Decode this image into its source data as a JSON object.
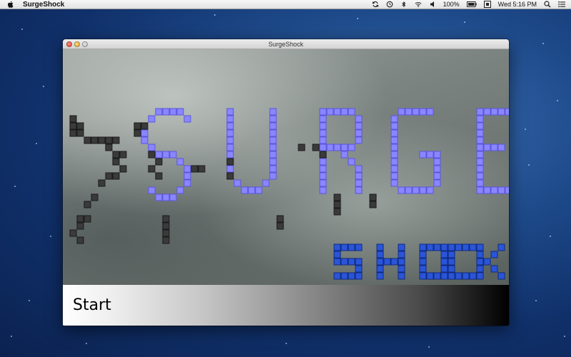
{
  "menubar": {
    "app_name": "SurgeShock",
    "battery": "100%",
    "clock": "Wed 5:16 PM"
  },
  "window": {
    "title": "SurgeShock"
  },
  "game": {
    "start_label": "Start"
  },
  "colors": {
    "title_blue": "#8a86ff",
    "title_blue_dark": "#5a56d8",
    "dark_block": "#3a3a3a",
    "shock_blue": "#2a55d8"
  }
}
